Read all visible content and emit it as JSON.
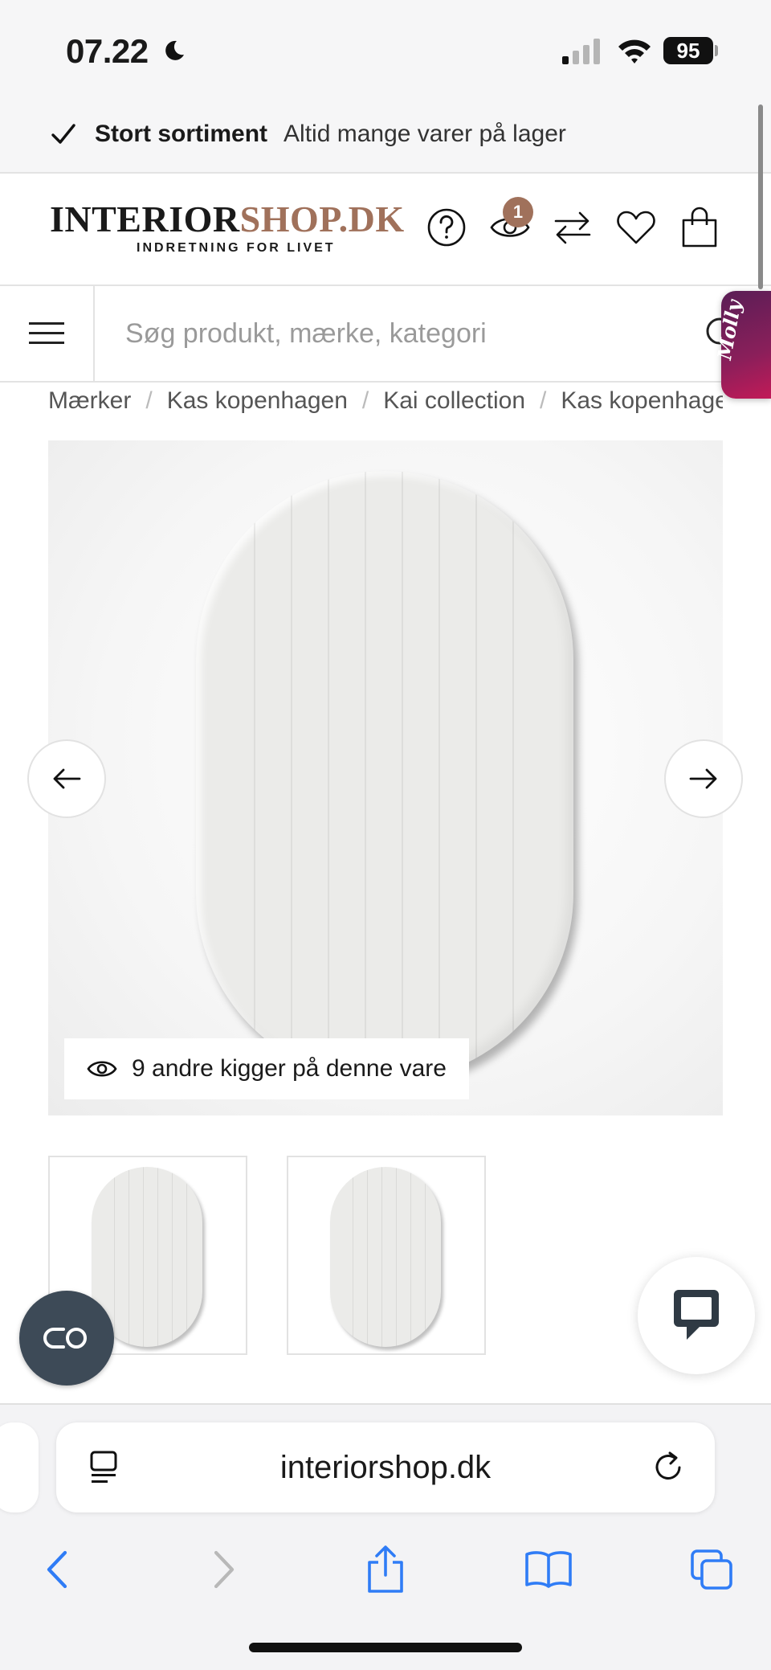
{
  "status_bar": {
    "time": "07.22",
    "battery": "95",
    "moon_icon": "moon-icon",
    "signal_icon": "cellular-signal-icon",
    "wifi_icon": "wifi-icon"
  },
  "promo": {
    "icon": "check-icon",
    "strong": "Stort sortiment",
    "text": "Altid mange varer på lager"
  },
  "header": {
    "logo_part1": "INTERIOR",
    "logo_part2": "SHOP.DK",
    "logo_tagline": "INDRETNING FOR LIVET",
    "recently_viewed_count": "1",
    "icons": [
      "help-icon",
      "eye-icon",
      "compare-icon",
      "heart-icon",
      "shopping-bag-icon"
    ]
  },
  "search": {
    "placeholder": "Søg produkt, mærke, kategori"
  },
  "molly": {
    "label": "Molly"
  },
  "breadcrumb": [
    "Mærker",
    "Kas kopenhagen",
    "Kai collection",
    "Kas kopenhage"
  ],
  "breadcrumb_separator": "/",
  "product": {
    "viewers_text": "9 andre kigger på denne vare",
    "thumbnail_count": 2
  },
  "browser": {
    "url": "interiorshop.dk"
  },
  "colors": {
    "brand_brown": "#a0715b",
    "cookie_button": "#3d4a57",
    "ios_blue": "#2f7cf6",
    "molly_gradient_start": "#5a1e56",
    "molly_gradient_end": "#c21a58"
  }
}
